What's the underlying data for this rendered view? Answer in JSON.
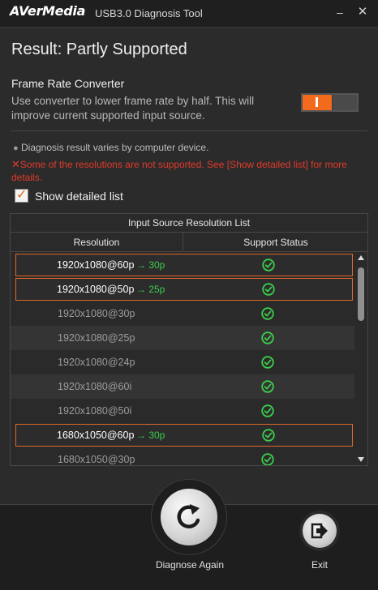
{
  "titlebar": {
    "brand": "AVerMedia",
    "app_title": "USB3.0 Diagnosis Tool",
    "minimize": "–",
    "close": "✕"
  },
  "result_title": "Result: Partly Supported",
  "frame_rate_converter": {
    "title": "Frame Rate Converter",
    "description": "Use converter to lower frame rate by half. This will improve current supported input source.",
    "toggle_state": "on",
    "toggle_on_color": "#f26b1d"
  },
  "notes": {
    "info": "Diagnosis result varies by computer device.",
    "warning": "Some of the resolutions are not supported. See [Show detailed list] for more details.",
    "warning_color": "#e23a2b"
  },
  "show_detailed_list": {
    "label": "Show detailed list",
    "checked": true
  },
  "list": {
    "title": "Input Source Resolution List",
    "columns": [
      "Resolution",
      "Support Status"
    ],
    "rows": [
      {
        "resolution": "1920x1080@60p",
        "converted": "→ 30p",
        "status": "supported",
        "highlighted": true
      },
      {
        "resolution": "1920x1080@50p",
        "converted": "→ 25p",
        "status": "supported",
        "highlighted": true
      },
      {
        "resolution": "1920x1080@30p",
        "converted": "",
        "status": "supported",
        "highlighted": false
      },
      {
        "resolution": "1920x1080@25p",
        "converted": "",
        "status": "supported",
        "highlighted": false
      },
      {
        "resolution": "1920x1080@24p",
        "converted": "",
        "status": "supported",
        "highlighted": false
      },
      {
        "resolution": "1920x1080@60i",
        "converted": "",
        "status": "supported",
        "highlighted": false
      },
      {
        "resolution": "1920x1080@50i",
        "converted": "",
        "status": "supported",
        "highlighted": false
      },
      {
        "resolution": "1680x1050@60p",
        "converted": "→ 30p",
        "status": "supported",
        "highlighted": true
      },
      {
        "resolution": "1680x1050@30p",
        "converted": "",
        "status": "supported",
        "highlighted": false
      }
    ],
    "highlight_color": "#e0692a",
    "supported_color": "#3ccd4c"
  },
  "actions": {
    "diagnose_again": "Diagnose Again",
    "exit": "Exit"
  }
}
